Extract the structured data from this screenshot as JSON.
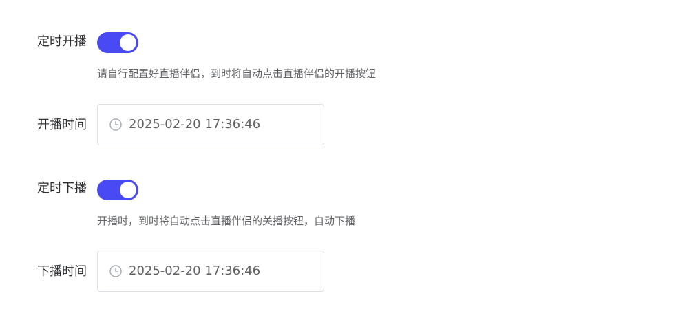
{
  "colors": {
    "accent": "#4a4af4",
    "border": "#dcdfe6",
    "icon": "#a8abb2"
  },
  "form": {
    "schedule_start": {
      "label": "定时开播",
      "enabled": true,
      "hint": "请自行配置好直播伴侣，到时将自动点击直播伴侣的开播按钮"
    },
    "start_time": {
      "label": "开播时间",
      "icon": "clock-icon",
      "value": "2025-02-20 17:36:46"
    },
    "schedule_stop": {
      "label": "定时下播",
      "enabled": true,
      "hint": "开播时，到时将自动点击直播伴侣的关播按钮，自动下播"
    },
    "stop_time": {
      "label": "下播时间",
      "icon": "clock-icon",
      "value": "2025-02-20 17:36:46"
    }
  }
}
